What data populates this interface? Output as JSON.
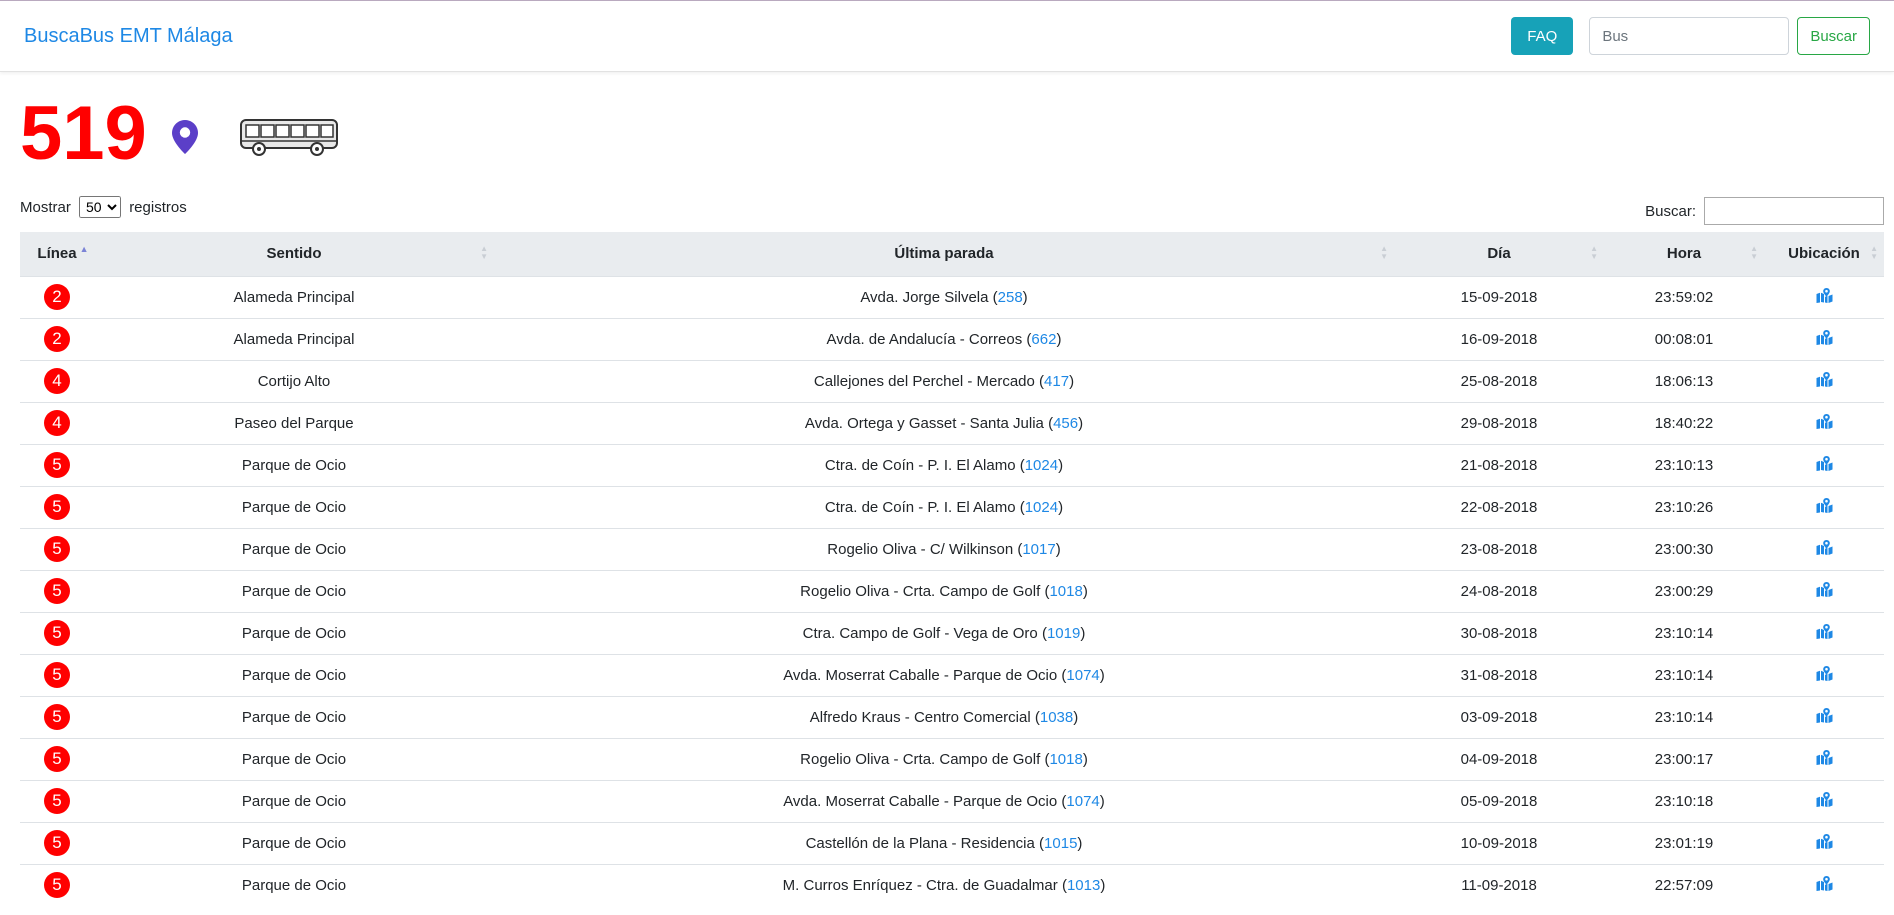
{
  "nav": {
    "brand": "BuscaBus EMT Málaga",
    "faq_label": "FAQ",
    "search_placeholder": "Bus",
    "search_button": "Buscar"
  },
  "bus": {
    "number": "519"
  },
  "controls": {
    "show_prefix": "Mostrar",
    "show_value": "50",
    "show_suffix": "registros",
    "filter_label": "Buscar:"
  },
  "colors": {
    "accent": "#1e88e5",
    "bus_number": "#ff0000",
    "pin": "#5b3fc8",
    "faq_button": "#17a2b8",
    "search_button": "#28a745"
  },
  "table": {
    "headers": {
      "linea": "Línea",
      "sentido": "Sentido",
      "ultima_parada": "Última parada",
      "dia": "Día",
      "hora": "Hora",
      "ubicacion": "Ubicación"
    },
    "rows": [
      {
        "line": "2",
        "direction": "Alameda Principal",
        "stop": "Avda. Jorge Silvela",
        "stop_id": "258",
        "day": "15-09-2018",
        "time": "23:59:02"
      },
      {
        "line": "2",
        "direction": "Alameda Principal",
        "stop": "Avda. de Andalucía - Correos",
        "stop_id": "662",
        "day": "16-09-2018",
        "time": "00:08:01"
      },
      {
        "line": "4",
        "direction": "Cortijo Alto",
        "stop": "Callejones del Perchel - Mercado",
        "stop_id": "417",
        "day": "25-08-2018",
        "time": "18:06:13"
      },
      {
        "line": "4",
        "direction": "Paseo del Parque",
        "stop": "Avda. Ortega y Gasset - Santa Julia",
        "stop_id": "456",
        "day": "29-08-2018",
        "time": "18:40:22"
      },
      {
        "line": "5",
        "direction": "Parque de Ocio",
        "stop": "Ctra. de Coín - P. I. El Alamo",
        "stop_id": "1024",
        "day": "21-08-2018",
        "time": "23:10:13"
      },
      {
        "line": "5",
        "direction": "Parque de Ocio",
        "stop": "Ctra. de Coín - P. I. El Alamo",
        "stop_id": "1024",
        "day": "22-08-2018",
        "time": "23:10:26"
      },
      {
        "line": "5",
        "direction": "Parque de Ocio",
        "stop": "Rogelio Oliva - C/ Wilkinson",
        "stop_id": "1017",
        "day": "23-08-2018",
        "time": "23:00:30"
      },
      {
        "line": "5",
        "direction": "Parque de Ocio",
        "stop": "Rogelio Oliva - Crta. Campo de Golf",
        "stop_id": "1018",
        "day": "24-08-2018",
        "time": "23:00:29"
      },
      {
        "line": "5",
        "direction": "Parque de Ocio",
        "stop": "Ctra. Campo de Golf - Vega de Oro",
        "stop_id": "1019",
        "day": "30-08-2018",
        "time": "23:10:14"
      },
      {
        "line": "5",
        "direction": "Parque de Ocio",
        "stop": "Avda. Moserrat Caballe - Parque de Ocio",
        "stop_id": "1074",
        "day": "31-08-2018",
        "time": "23:10:14"
      },
      {
        "line": "5",
        "direction": "Parque de Ocio",
        "stop": "Alfredo Kraus - Centro Comercial",
        "stop_id": "1038",
        "day": "03-09-2018",
        "time": "23:10:14"
      },
      {
        "line": "5",
        "direction": "Parque de Ocio",
        "stop": "Rogelio Oliva - Crta. Campo de Golf",
        "stop_id": "1018",
        "day": "04-09-2018",
        "time": "23:00:17"
      },
      {
        "line": "5",
        "direction": "Parque de Ocio",
        "stop": "Avda. Moserrat Caballe - Parque de Ocio",
        "stop_id": "1074",
        "day": "05-09-2018",
        "time": "23:10:18"
      },
      {
        "line": "5",
        "direction": "Parque de Ocio",
        "stop": "Castellón de la Plana - Residencia",
        "stop_id": "1015",
        "day": "10-09-2018",
        "time": "23:01:19"
      },
      {
        "line": "5",
        "direction": "Parque de Ocio",
        "stop": "M. Curros Enríquez - Ctra. de Guadalmar",
        "stop_id": "1013",
        "day": "11-09-2018",
        "time": "22:57:09"
      }
    ]
  }
}
